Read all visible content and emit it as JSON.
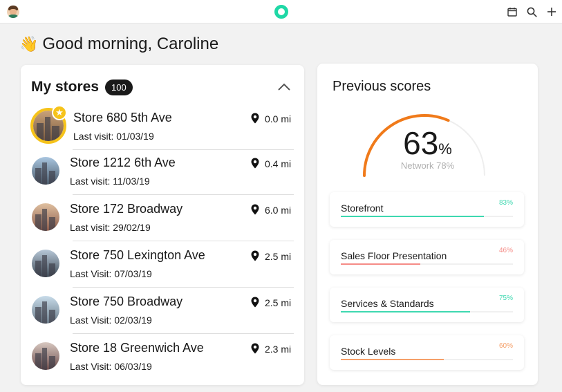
{
  "header": {
    "icons": [
      "avatar",
      "app-logo",
      "calendar-icon",
      "search-icon",
      "plus-icon"
    ],
    "accent": "#1fd8a6"
  },
  "greeting": {
    "emoji": "👋",
    "text": "Good morning, Caroline"
  },
  "stores": {
    "title": "My stores",
    "count": "100",
    "items": [
      {
        "name": "Store 680 5th Ave",
        "visit": "Last visit: 01/03/19",
        "distance": "0.0 mi",
        "featured": true,
        "colors": [
          "#c9a27a",
          "#7a5a3e"
        ]
      },
      {
        "name": "Store 1212 6th Ave",
        "visit": "Last visit: 11/03/19",
        "distance": "0.4 mi",
        "featured": false,
        "colors": [
          "#a9c6e0",
          "#4a5a6a"
        ]
      },
      {
        "name": "Store 172 Broadway",
        "visit": "Last visit: 29/02/19",
        "distance": "6.0 mi",
        "featured": false,
        "colors": [
          "#e0c0a0",
          "#8a5a4a"
        ]
      },
      {
        "name": "Store 750 Lexington Ave",
        "visit": "Last Visit: 07/03/19",
        "distance": "2.5 mi",
        "featured": false,
        "colors": [
          "#b8c8d8",
          "#3e4a56"
        ]
      },
      {
        "name": "Store 750 Broadway",
        "visit": "Last Visit: 02/03/19",
        "distance": "2.5 mi",
        "featured": false,
        "colors": [
          "#c8dcea",
          "#6a7a88"
        ]
      },
      {
        "name": "Store 18 Greenwich Ave",
        "visit": "Last Visit: 06/03/19",
        "distance": "2.3 mi",
        "featured": false,
        "colors": [
          "#d8c8c0",
          "#6a4a4a"
        ]
      }
    ]
  },
  "scores": {
    "title": "Previous scores",
    "value": "63",
    "unit": "%",
    "value_fraction": 0.63,
    "network": "Network 78%",
    "gauge_color": "#f07a1a",
    "metrics": [
      {
        "name": "Storefront",
        "percent": "83%",
        "fraction": 0.83,
        "color": "#3ed8b0"
      },
      {
        "name": "Sales Floor Presentation",
        "percent": "46%",
        "fraction": 0.46,
        "color": "#f58b86"
      },
      {
        "name": "Services & Standards",
        "percent": "75%",
        "fraction": 0.75,
        "color": "#3ed8b0"
      },
      {
        "name": "Stock Levels",
        "percent": "60%",
        "fraction": 0.6,
        "color": "#f5a06a"
      }
    ]
  }
}
